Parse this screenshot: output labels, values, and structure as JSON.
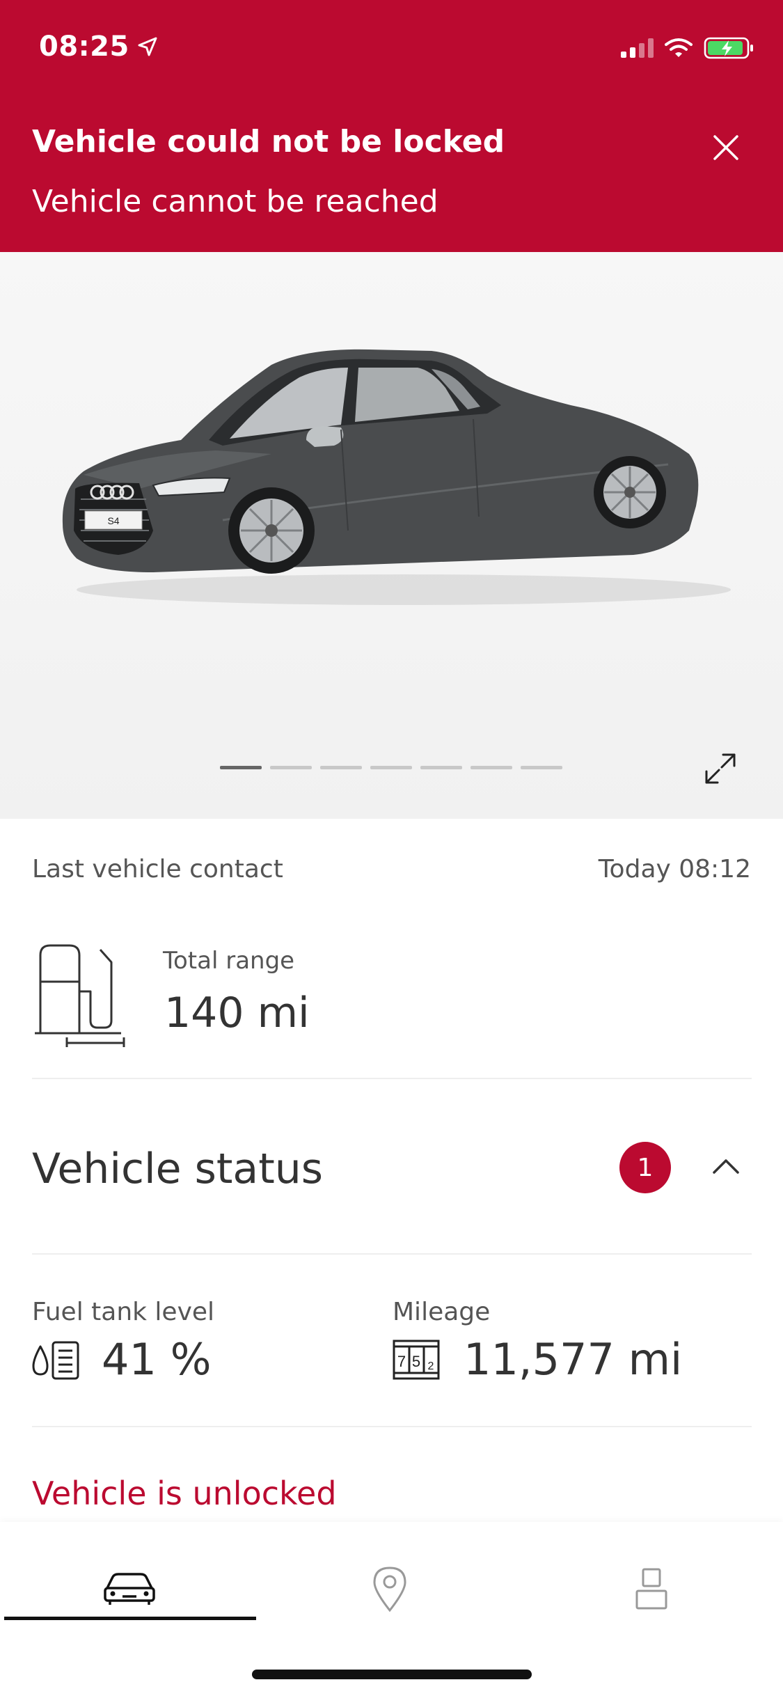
{
  "status_bar": {
    "time": "08:25"
  },
  "alert_banner": {
    "title": "Vehicle could not be locked",
    "message": "Vehicle cannot be reached"
  },
  "hero": {
    "plate_text": "S4",
    "gallery_total": 7,
    "gallery_active_index": 0
  },
  "last_contact": {
    "label": "Last vehicle contact",
    "value": "Today 08:12"
  },
  "range": {
    "label": "Total range",
    "value": "140 mi"
  },
  "vehicle_status": {
    "title": "Vehicle status",
    "badge_count": "1"
  },
  "fuel": {
    "label": "Fuel tank level",
    "value": "41 %"
  },
  "mileage": {
    "label": "Mileage",
    "value": "11,577 mi"
  },
  "alert_line": {
    "text": "Vehicle is unlocked"
  },
  "colors": {
    "brand_red": "#bb0a30",
    "text_dark": "#333333",
    "text_muted": "#555555"
  },
  "nav": {
    "items": [
      "car-icon",
      "location-pin-icon",
      "profile-icon"
    ],
    "active_index": 0
  }
}
